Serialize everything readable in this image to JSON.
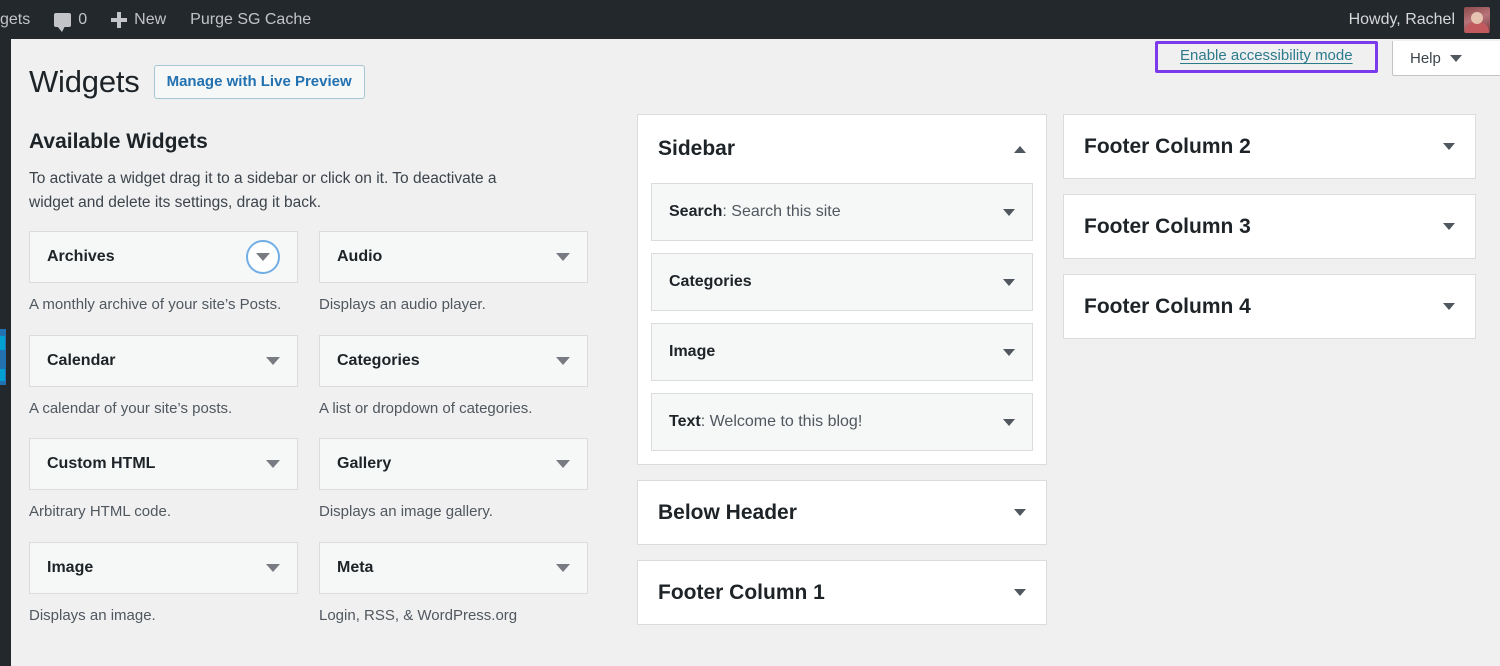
{
  "adminbar": {
    "site_label": "gets",
    "comments_icon": "comment-bubble-icon",
    "comments_count": "0",
    "new_icon": "plus-icon",
    "new_label": "New",
    "purge_label": "Purge SG Cache",
    "howdy": "Howdy, Rachel",
    "avatar_icon": "user-avatar"
  },
  "screen_meta": {
    "accessibility_link": "Enable accessibility mode",
    "help_label": "Help",
    "help_caret_icon": "chevron-down-icon",
    "highlight_color": "#7c3aed",
    "link_color": "#2c7a8c"
  },
  "header": {
    "title": "Widgets",
    "live_preview_button": "Manage with Live Preview"
  },
  "available": {
    "title": "Available Widgets",
    "description": "To activate a widget drag it to a sidebar or click on it. To deactivate a widget and delete its settings, drag it back.",
    "widgets": [
      {
        "name": "Archives",
        "desc": "A monthly archive of your site’s Posts.",
        "toggle_icon": "chevron-down-icon",
        "focused": true
      },
      {
        "name": "Audio",
        "desc": "Displays an audio player.",
        "toggle_icon": "chevron-down-icon",
        "focused": false
      },
      {
        "name": "Calendar",
        "desc": "A calendar of your site’s posts.",
        "toggle_icon": "chevron-down-icon",
        "focused": false
      },
      {
        "name": "Categories",
        "desc": "A list or dropdown of categories.",
        "toggle_icon": "chevron-down-icon",
        "focused": false
      },
      {
        "name": "Custom HTML",
        "desc": "Arbitrary HTML code.",
        "toggle_icon": "chevron-down-icon",
        "focused": false
      },
      {
        "name": "Gallery",
        "desc": "Displays an image gallery.",
        "toggle_icon": "chevron-down-icon",
        "focused": false
      },
      {
        "name": "Image",
        "desc": "Displays an image.",
        "toggle_icon": "chevron-down-icon",
        "focused": false
      },
      {
        "name": "Meta",
        "desc": "Login, RSS, & WordPress.org",
        "toggle_icon": "chevron-down-icon",
        "focused": false
      }
    ]
  },
  "middle_column": {
    "panels": [
      {
        "title": "Sidebar",
        "expanded": true,
        "toggle_icon": "chevron-up-icon",
        "widgets": [
          {
            "prefix": "Search",
            "label": "Search this site",
            "toggle_icon": "chevron-down-icon"
          },
          {
            "prefix": "",
            "label": "Categories",
            "toggle_icon": "chevron-down-icon"
          },
          {
            "prefix": "",
            "label": "Image",
            "toggle_icon": "chevron-down-icon"
          },
          {
            "prefix": "Text",
            "label": "Welcome to this blog!",
            "toggle_icon": "chevron-down-icon"
          }
        ]
      },
      {
        "title": "Below Header",
        "expanded": false,
        "toggle_icon": "chevron-down-icon",
        "widgets": []
      },
      {
        "title": "Footer Column 1",
        "expanded": false,
        "toggle_icon": "chevron-down-icon",
        "widgets": []
      }
    ]
  },
  "right_column": {
    "panels": [
      {
        "title": "Footer Column 2",
        "expanded": false,
        "toggle_icon": "chevron-down-icon",
        "widgets": []
      },
      {
        "title": "Footer Column 3",
        "expanded": false,
        "toggle_icon": "chevron-down-icon",
        "widgets": []
      },
      {
        "title": "Footer Column 4",
        "expanded": false,
        "toggle_icon": "chevron-down-icon",
        "widgets": []
      }
    ]
  }
}
